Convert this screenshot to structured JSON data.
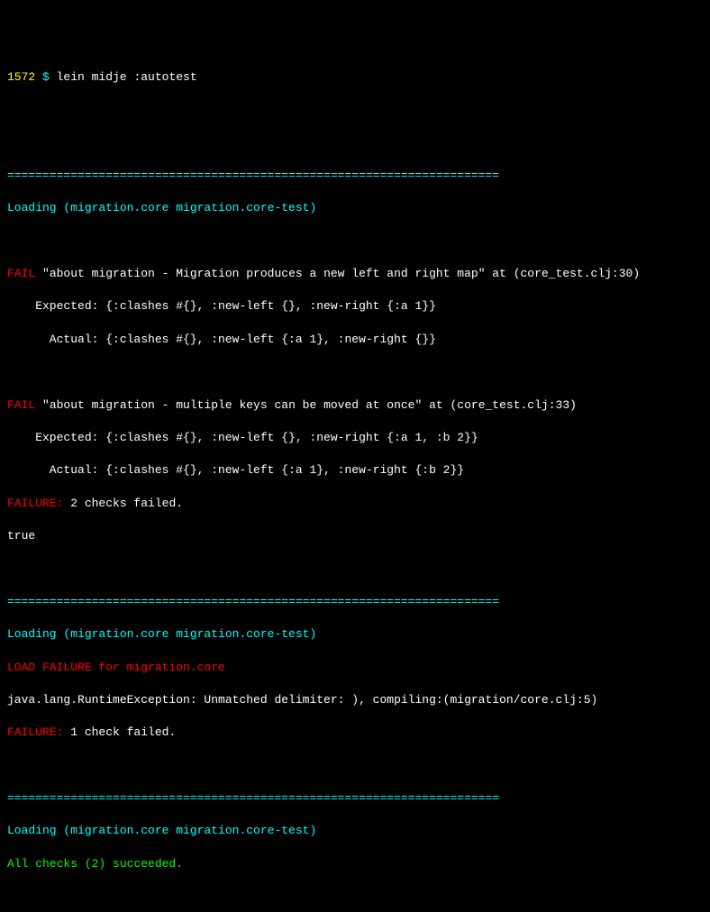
{
  "prompt": {
    "number": "1572 ",
    "symbol": "$ ",
    "command": "lein midje :autotest"
  },
  "divider": "======================================================================",
  "sections": [
    {
      "loading": "Loading (migration.core migration.core-test)",
      "fails": [
        {
          "prefix": "FAIL",
          "message": " \"about migration - Migration produces a new left and right map\" at (core_test.clj:30)",
          "expected": "    Expected: {:clashes #{}, :new-left {}, :new-right {:a 1}}",
          "actual": "      Actual: {:clashes #{}, :new-left {:a 1}, :new-right {}}"
        },
        {
          "prefix": "FAIL",
          "message": " \"about migration - multiple keys can be moved at once\" at (core_test.clj:33)",
          "expected": "    Expected: {:clashes #{}, :new-left {}, :new-right {:a 1, :b 2}}",
          "actual": "      Actual: {:clashes #{}, :new-left {:a 1}, :new-right {:b 2}}"
        }
      ],
      "failure_prefix": "FAILURE:",
      "failure_msg": " 2 checks failed.",
      "after": "true"
    },
    {
      "loading": "Loading (migration.core migration.core-test)",
      "load_failure": "LOAD FAILURE for migration.core",
      "exception": "java.lang.RuntimeException: Unmatched delimiter: ), compiling:(migration/core.clj:5)",
      "failure_prefix": "FAILURE:",
      "failure_msg": " 1 check failed."
    },
    {
      "loading": "Loading (migration.core migration.core-test)",
      "success": "All checks (2) succeeded."
    }
  ]
}
